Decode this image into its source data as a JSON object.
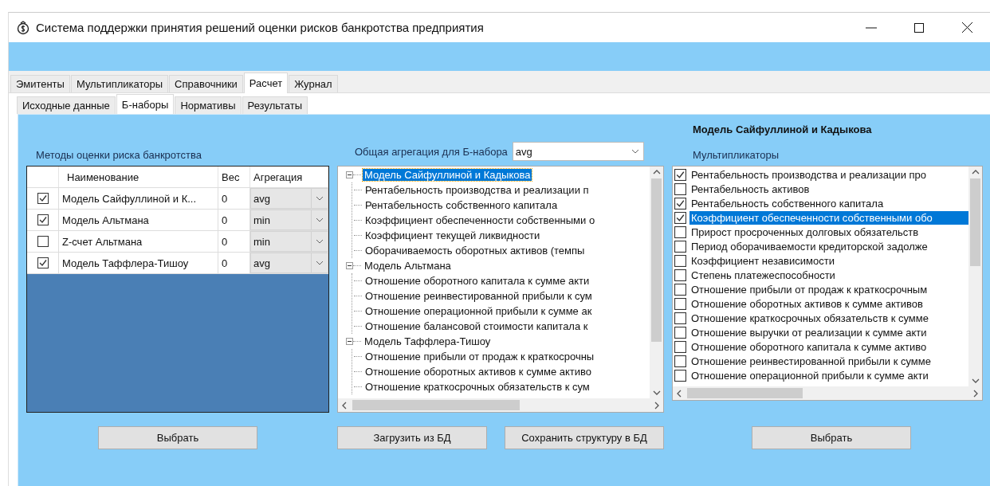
{
  "window": {
    "title": "Система поддержки принятия решений оценки рисков банкротства предприятия"
  },
  "tabs": [
    {
      "label": "Эмитенты",
      "selected": false
    },
    {
      "label": "Мультипликаторы",
      "selected": false
    },
    {
      "label": "Справочники",
      "selected": false
    },
    {
      "label": "Расчет",
      "selected": true
    },
    {
      "label": "Журнал",
      "selected": false
    }
  ],
  "sub_tabs": [
    {
      "label": "Исходные данные",
      "selected": false
    },
    {
      "label": "Б-наборы",
      "selected": true
    },
    {
      "label": "Нормативы",
      "selected": false
    },
    {
      "label": "Результаты",
      "selected": false
    }
  ],
  "methods": {
    "label": "Методы оценки риска банкротства",
    "columns": [
      "Наименование",
      "Вес",
      "Агрегация"
    ],
    "rows": [
      {
        "checked": true,
        "name": "Модель Сайфуллиной и К...",
        "weight": "0",
        "aggregation": "avg"
      },
      {
        "checked": true,
        "name": "Модель Альтмана",
        "weight": "0",
        "aggregation": "min"
      },
      {
        "checked": false,
        "name": "Z-счет Альтмана",
        "weight": "0",
        "aggregation": "min"
      },
      {
        "checked": true,
        "name": "Модель Таффлера-Тишоу",
        "weight": "0",
        "aggregation": "avg"
      }
    ],
    "button": "Выбрать"
  },
  "structure": {
    "aggregation_label": "Общая агрегация для Б-набора",
    "aggregation_value": "avg",
    "tree": [
      {
        "label": "Модель Сайфуллиной и Кадыкова",
        "selected": true,
        "expanded": true,
        "children": [
          {
            "label": "Рентабельность производства и реализации п"
          },
          {
            "label": "Рентабельность собственного капитала"
          },
          {
            "label": "Коэффициент обеспеченности собственными о"
          },
          {
            "label": "Коэффициент текущей ликвидности"
          },
          {
            "label": "Оборачиваемость оборотных активов (темпы"
          }
        ]
      },
      {
        "label": "Модель Альтмана",
        "selected": false,
        "expanded": true,
        "children": [
          {
            "label": "Отношение оборотного капитала к сумме акти"
          },
          {
            "label": "Отношение реинвестированной прибыли к сум"
          },
          {
            "label": "Отношение операционной прибыли к сумме ак"
          },
          {
            "label": "Отношение балансовой стоимости капитала к"
          }
        ]
      },
      {
        "label": "Модель Таффлера-Тишоу",
        "selected": false,
        "expanded": true,
        "children": [
          {
            "label": "Отношение прибыли от продаж к краткосрочны"
          },
          {
            "label": "Отношение оборотных активов к сумме активо"
          },
          {
            "label": "Отношение краткосрочных обязательств к сум"
          }
        ]
      }
    ],
    "buttons": [
      "Загрузить из БД",
      "Сохранить структуру в БД"
    ]
  },
  "model": {
    "title": "Модель Сайфуллиной и Кадыкова",
    "multipliers_label": "Мультипликаторы",
    "multipliers": [
      {
        "label": "Рентабельность производства и реализации про",
        "checked": true,
        "selected": false
      },
      {
        "label": "Рентабельность активов",
        "checked": false,
        "selected": false
      },
      {
        "label": "Рентабельность собственного капитала",
        "checked": true,
        "selected": false
      },
      {
        "label": "Коэффициент обеспеченности собственными обо",
        "checked": true,
        "selected": true
      },
      {
        "label": "Прирост просроченных долговых обязательств",
        "checked": false,
        "selected": false
      },
      {
        "label": "Период оборачиваемости кредиторской задолже",
        "checked": false,
        "selected": false
      },
      {
        "label": "Коэффициент независимости",
        "checked": false,
        "selected": false
      },
      {
        "label": "Степень платежеспособности",
        "checked": false,
        "selected": false
      },
      {
        "label": "Отношение прибыли от продаж к краткосрочным",
        "checked": false,
        "selected": false
      },
      {
        "label": "Отношение оборотных активов к сумме активов",
        "checked": false,
        "selected": false
      },
      {
        "label": "Отношение краткосрочных обязательств к сумме",
        "checked": false,
        "selected": false
      },
      {
        "label": "Отношение выручки от реализации к сумме акти",
        "checked": false,
        "selected": false
      },
      {
        "label": "Отношение оборотного капитала к сумме активо",
        "checked": false,
        "selected": false
      },
      {
        "label": "Отношение реинвестированной прибыли к сумме",
        "checked": false,
        "selected": false
      },
      {
        "label": "Отношение операционной прибыли к сумме акти",
        "checked": false,
        "selected": false
      }
    ],
    "button": "Выбрать"
  }
}
